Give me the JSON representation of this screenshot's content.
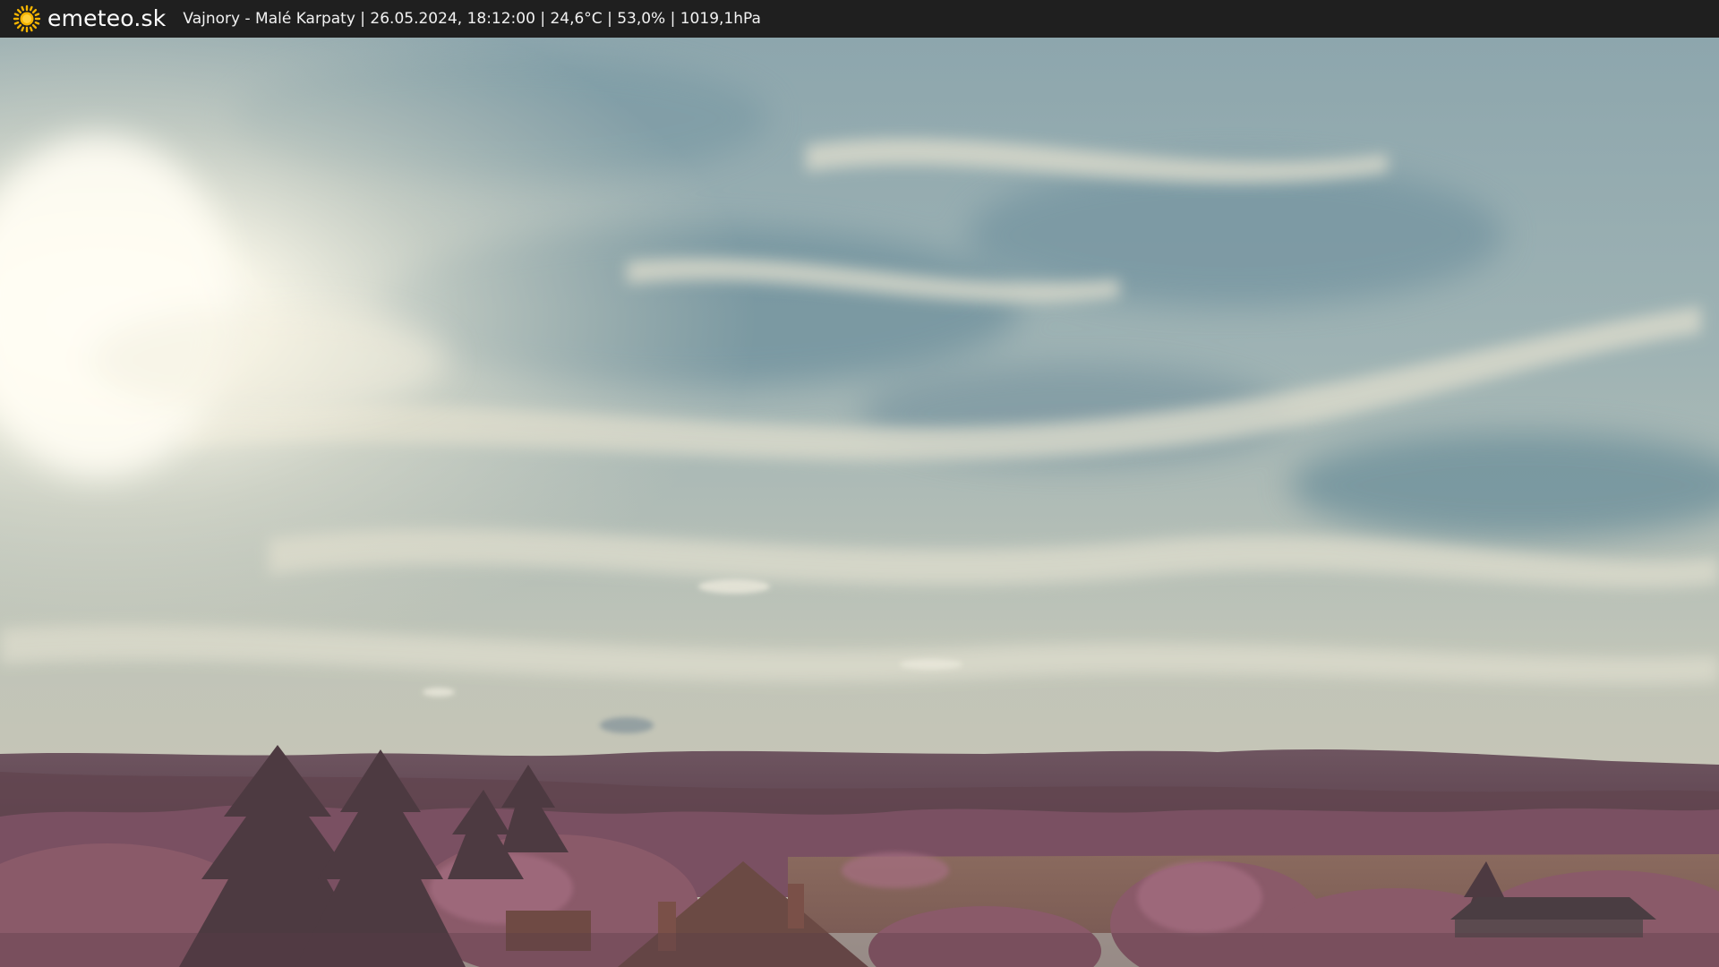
{
  "header": {
    "logo_icon": "sun-icon",
    "brand": "emeteo.sk",
    "info": "Vajnory - Malé Karpaty | 26.05.2024, 18:12:00 | 24,6°C | 53,0% | 1019,1hPa"
  },
  "webcam_image": {
    "subject": "infrared-tinted sky with cirrus clouds, sun glare at top-left, forested hills of Malé Karpaty, pinkish trees and rooftops in foreground"
  },
  "colors": {
    "bar": "#1f1f1f",
    "sun": "#f4b400",
    "sky_blue": "#7e9ca4",
    "cloud": "#d9d6c4",
    "hills": "#6b4d58",
    "foliage": "#8a5a69"
  }
}
